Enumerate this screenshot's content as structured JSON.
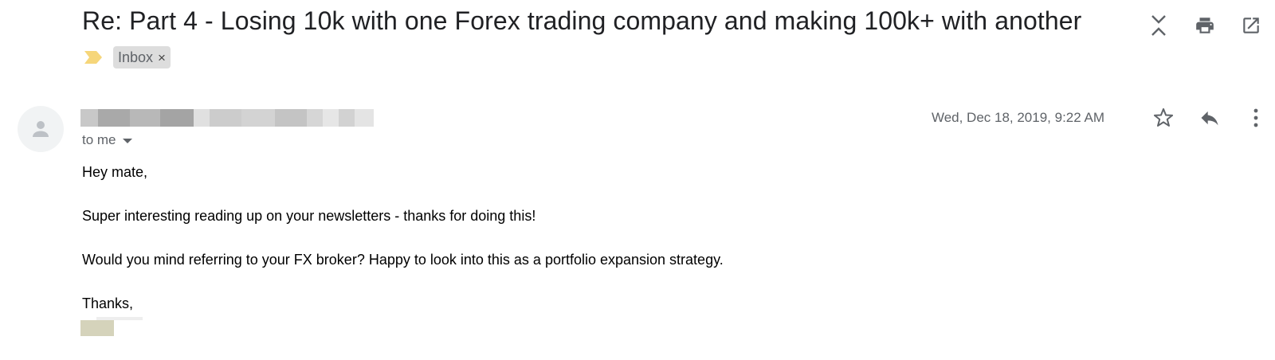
{
  "email": {
    "subject": "Re: Part 4 - Losing 10k with one Forex trading company and making 100k+ with another",
    "label": "Inbox",
    "label_remove_glyph": "×",
    "recipient_text": "to me",
    "date": "Wed, Dec 18, 2019, 9:22 AM",
    "body": {
      "greeting": "Hey mate,",
      "line1": "Super interesting reading up on your newsletters - thanks for doing this!",
      "line2": "Would you mind referring to your FX broker? Happy to look into this as a portfolio expansion strategy.",
      "closing": "Thanks,"
    }
  },
  "icons": {
    "header": [
      "collapse-all-icon",
      "print-icon",
      "open-in-new-window-icon"
    ],
    "message": [
      "star-icon",
      "reply-icon",
      "more-vert-icon"
    ],
    "importance": "importance-marker-icon",
    "avatar": "default-avatar-icon"
  },
  "colors": {
    "text_primary": "#202124",
    "text_secondary": "#5f6368",
    "importance_yellow": "#f6d67a",
    "chip_background": "#dddddd",
    "avatar_background": "#f1f3f4"
  }
}
